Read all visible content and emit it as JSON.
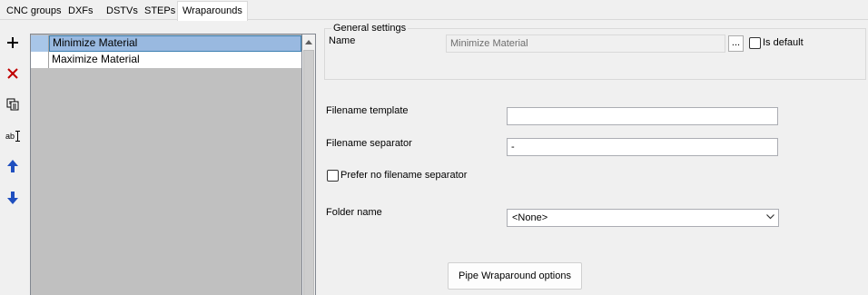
{
  "tabs": [
    {
      "label": "CNC groups"
    },
    {
      "label": "DXFs"
    },
    {
      "label": "DSTVs"
    },
    {
      "label": "STEPs"
    },
    {
      "label": "Wraparounds"
    }
  ],
  "toolbar": {
    "add_icon": "plus-icon",
    "delete_icon": "delete-x-icon",
    "copy_icon": "copy-icon",
    "rename_icon": "rename-icon",
    "rename_glyph": "ab",
    "up_icon": "arrow-up-icon",
    "down_icon": "arrow-down-icon"
  },
  "list": {
    "items": [
      {
        "label": "Minimize Material",
        "selected": true
      },
      {
        "label": "Maximize Material",
        "selected": false
      }
    ]
  },
  "general": {
    "title": "General settings",
    "name_label": "Name",
    "name_value": "Minimize Material",
    "browse_label": "...",
    "is_default_label": "Is default"
  },
  "form": {
    "filename_template_label": "Filename template",
    "filename_template_value": "",
    "filename_separator_label": "Filename separator",
    "filename_separator_value": "-",
    "prefer_no_separator_label": "Prefer no filename separator",
    "folder_name_label": "Folder name",
    "folder_name_value": "<None>",
    "pipe_options_label": "Pipe Wraparound options"
  },
  "colors": {
    "selection_bg": "#99b9e0",
    "selection_border": "#3c7fb1",
    "list_bg": "#c0c0c0",
    "window_bg": "#f0f0f0",
    "delete_red": "#c00000",
    "arrow_blue": "#1f4fbf"
  }
}
